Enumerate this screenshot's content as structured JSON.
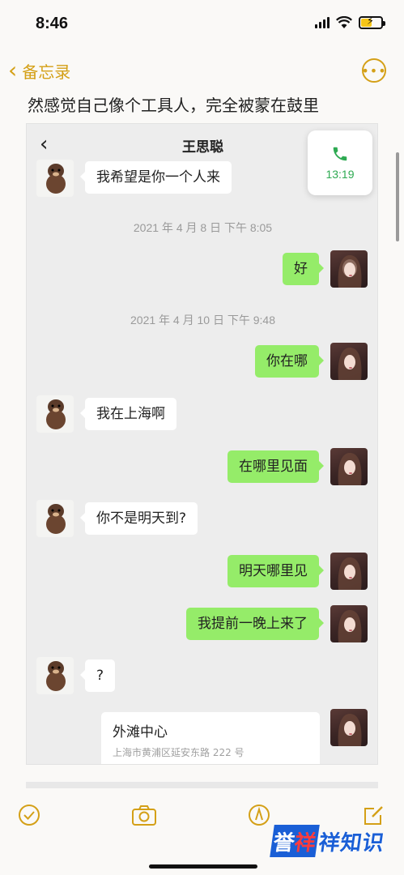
{
  "status_bar": {
    "time": "8:46"
  },
  "notes_nav": {
    "back_label": "备忘录"
  },
  "note": {
    "text_line": "然感觉自己像个工具人，完全被蒙在鼓里"
  },
  "chat": {
    "title": "王思聪",
    "call": {
      "duration": "13:19"
    },
    "messages": [
      {
        "side": "in",
        "text": "我希望是你一个人来"
      },
      {
        "type": "timestamp",
        "text": "2021 年 4 月 8 日  下午 8:05"
      },
      {
        "side": "out",
        "text": "好"
      },
      {
        "type": "timestamp",
        "text": "2021 年 4 月 10 日  下午 9:48"
      },
      {
        "side": "out",
        "text": "你在哪"
      },
      {
        "side": "in",
        "text": "我在上海啊"
      },
      {
        "side": "out",
        "text": "在哪里见面"
      },
      {
        "side": "in",
        "text": "你不是明天到?"
      },
      {
        "side": "out",
        "text": "明天哪里见"
      },
      {
        "side": "out",
        "text": "我提前一晚上来了"
      },
      {
        "side": "in",
        "text": "?"
      }
    ],
    "location": {
      "title": "外滩中心",
      "address": "上海市黄浦区延安东路 222 号"
    }
  },
  "watermark": {
    "logo_part1": "誉",
    "logo_part2": "祥",
    "text": "祥知识"
  },
  "colors": {
    "accent": "#d4a017",
    "bubble_out": "#95ec69",
    "call_green": "#2eaa52"
  },
  "icons": [
    "chevron-left-icon",
    "more-icon",
    "phone-icon",
    "check-circle-icon",
    "camera-icon",
    "pen-icon",
    "compose-icon",
    "battery-icon",
    "wifi-icon",
    "signal-icon"
  ]
}
